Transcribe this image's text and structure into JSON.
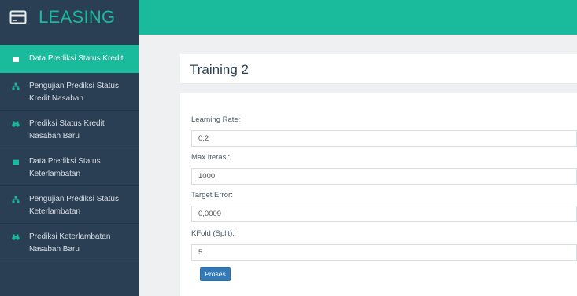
{
  "app": {
    "brand": "LEASING"
  },
  "sidebar": {
    "items": [
      {
        "label": "Data Prediksi Status Kredit",
        "icon": "document-icon",
        "active": true
      },
      {
        "label": "Pengujian Prediksi Status Kredit Nasabah",
        "icon": "sitemap-icon",
        "active": false
      },
      {
        "label": "Prediksi Status Kredit Nasabah Baru",
        "icon": "binoculars-icon",
        "active": false
      },
      {
        "label": "Data Prediksi Status Keterlambatan",
        "icon": "document-icon",
        "active": false
      },
      {
        "label": "Pengujian Prediksi Status Keterlambatan",
        "icon": "sitemap-icon",
        "active": false
      },
      {
        "label": "Prediksi Keterlambatan Nasabah Baru",
        "icon": "binoculars-icon",
        "active": false
      }
    ]
  },
  "page": {
    "title": "Training 2"
  },
  "form": {
    "learning_rate": {
      "label": "Learning Rate:",
      "value": "0,2"
    },
    "max_iterasi": {
      "label": "Max Iterasi:",
      "value": "1000"
    },
    "target_error": {
      "label": "Target Error:",
      "value": "0,0009"
    },
    "kfold": {
      "label": "KFold (Split):",
      "value": "5"
    },
    "submit_label": "Proses"
  },
  "colors": {
    "accent": "#1abb9c",
    "sidebar": "#2a3f54",
    "button": "#337ab7"
  }
}
